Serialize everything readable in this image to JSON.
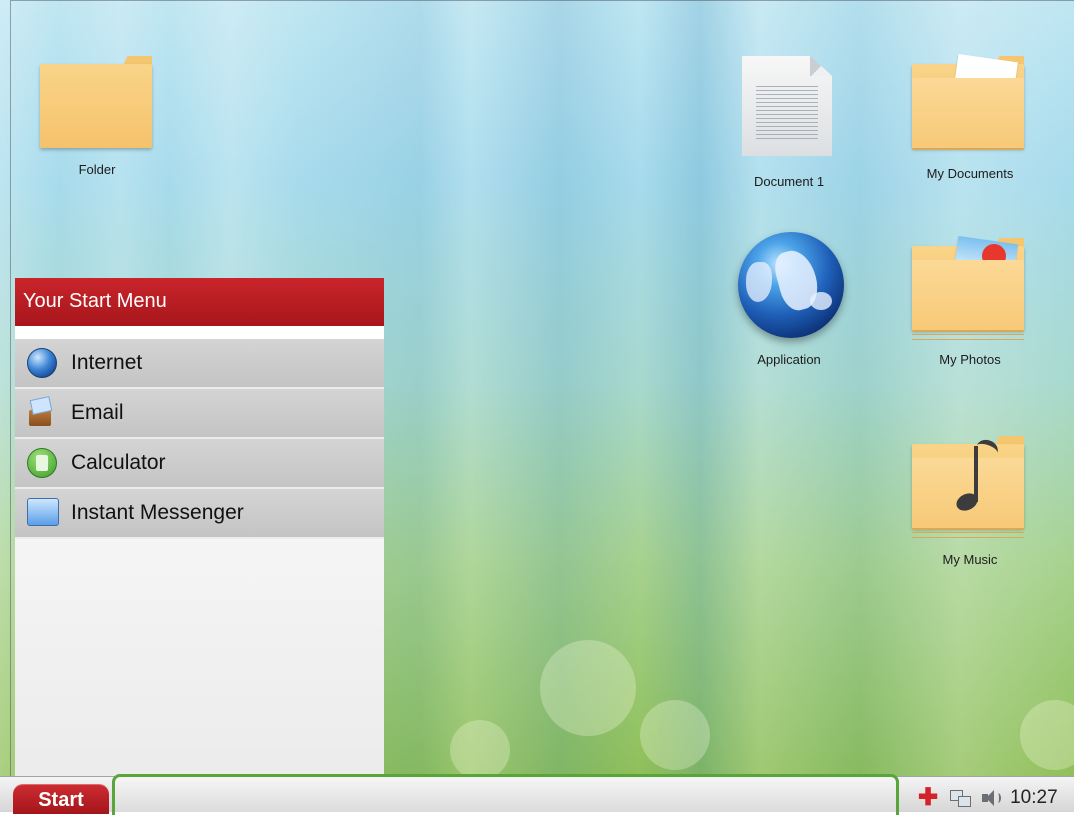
{
  "desktop": {
    "icons": {
      "folder": {
        "label": "Folder"
      },
      "document": {
        "label": "Document 1"
      },
      "application": {
        "label": "Application"
      },
      "my_documents": {
        "label": "My Documents"
      },
      "my_photos": {
        "label": "My Photos"
      },
      "my_music": {
        "label": "My Music"
      }
    }
  },
  "start_menu": {
    "header": "Your Start Menu",
    "items": [
      {
        "label": "Internet",
        "icon": "globe-icon"
      },
      {
        "label": "Email",
        "icon": "email-icon"
      },
      {
        "label": "Calculator",
        "icon": "calculator-icon"
      },
      {
        "label": "Instant Messenger",
        "icon": "messenger-icon"
      }
    ]
  },
  "taskbar": {
    "start_label": "Start",
    "clock": "10:27",
    "tray_icons": [
      "plus-icon",
      "network-icon",
      "volume-icon"
    ]
  },
  "colors": {
    "accent_red": "#b81c21",
    "taskbar_highlight": "#58a53a"
  }
}
